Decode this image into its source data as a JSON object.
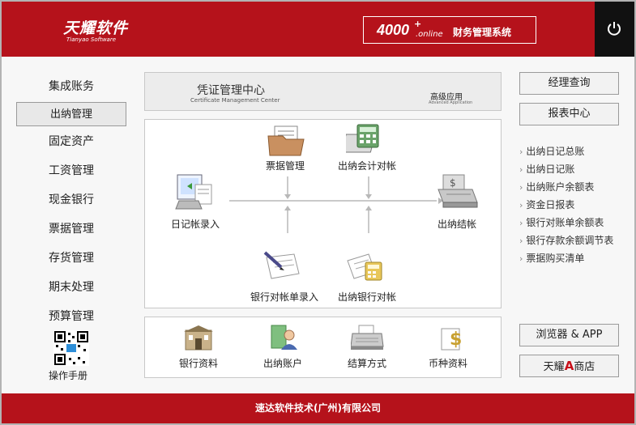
{
  "header": {
    "logo_cn": "天耀软件",
    "logo_en": "Tianyao Software",
    "sys_num": "4000",
    "sys_plus": "+",
    "sys_online": ".online",
    "sys_name": "财务管理系统"
  },
  "nav": {
    "items": [
      "集成账务",
      "出纳管理",
      "固定资产",
      "工资管理",
      "现金银行",
      "票据管理",
      "存货管理",
      "期末处理",
      "预算管理"
    ],
    "active": "出纳管理",
    "manual": "操作手册"
  },
  "banner": {
    "title": "凭证管理中心",
    "subtitle": "Certificate Management Center",
    "advanced": "高级应用",
    "advanced_en": "Advanced Application"
  },
  "flow": {
    "ticket": "票据管理",
    "reconcile_acct": "出纳会计对帐",
    "journal_entry": "日记帐录入",
    "closing": "出纳结帐",
    "bank_stmt_entry": "银行对帐单录入",
    "bank_reconcile": "出纳银行对帐"
  },
  "bottom": {
    "bank_info": "银行资料",
    "cashier_acct": "出纳账户",
    "settlement": "结算方式",
    "currency": "币种资料"
  },
  "right": {
    "manager_query": "经理查询",
    "report_center": "报表中心",
    "reports": [
      "出纳日记总账",
      "出纳日记账",
      "出纳账户余额表",
      "资金日报表",
      "银行对账单余额表",
      "银行存款余额调节表",
      "票据购买清单"
    ],
    "browser_app": "浏览器 & APP",
    "store_pre": "天耀",
    "store_a": "A",
    "store_post": "商店"
  },
  "footer": {
    "company": "速达软件技术(广州)有限公司"
  },
  "colors": {
    "brand_red": "#b5121b",
    "power_bg": "#111111"
  }
}
